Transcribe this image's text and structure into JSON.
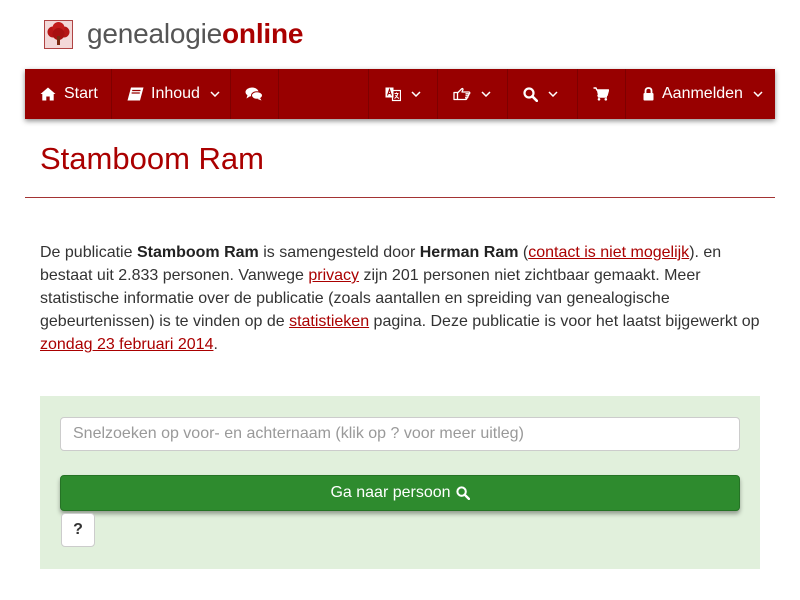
{
  "brand": {
    "part1": "genealogie",
    "part2": "online",
    "logo_icon": "tree-logo-icon"
  },
  "nav": {
    "start": {
      "label": "Start",
      "icon": "home-icon"
    },
    "inhoud": {
      "label": "Inhoud",
      "icon": "book-icon"
    },
    "forum": {
      "icon": "comments-icon"
    },
    "language": {
      "icon": "language-icon"
    },
    "share": {
      "icon": "hand-pointer-icon"
    },
    "search": {
      "icon": "search-icon"
    },
    "shop": {
      "icon": "shopping-cart-icon"
    },
    "login": {
      "label": "Aanmelden",
      "icon": "lock-icon"
    }
  },
  "page": {
    "title": "Stamboom Ram"
  },
  "intro": {
    "t1": "De publicatie ",
    "publication": "Stamboom Ram",
    "t2": " is samengesteld door ",
    "author": "Herman Ram",
    "t3": " (",
    "contact_link": "contact is niet mogelijk",
    "t4": "). en bestaat uit 2.833 personen. Vanwege ",
    "privacy_link": "privacy",
    "t5": " zijn 201 personen niet zichtbaar gemaakt. Meer statistische informatie over de publicatie (zoals aantallen en spreiding van genealogische gebeurtenissen) is te vinden op de ",
    "stats_link": "statistieken",
    "t6": " pagina. Deze publicatie is voor het laatst bijgewerkt op ",
    "date_link": "zondag 23 februari 2014",
    "t7": "."
  },
  "search": {
    "placeholder": "Snelzoeken op voor- en achternaam (klik op ? voor meer uitleg)",
    "value": "",
    "go_label": "Ga naar persoon",
    "help_label": "?"
  },
  "colors": {
    "navbar": "#980000",
    "brand_accent": "#aa0000",
    "link": "#aa0000",
    "panel": "#e1f0dc",
    "go_button": "#2e8b2e"
  }
}
